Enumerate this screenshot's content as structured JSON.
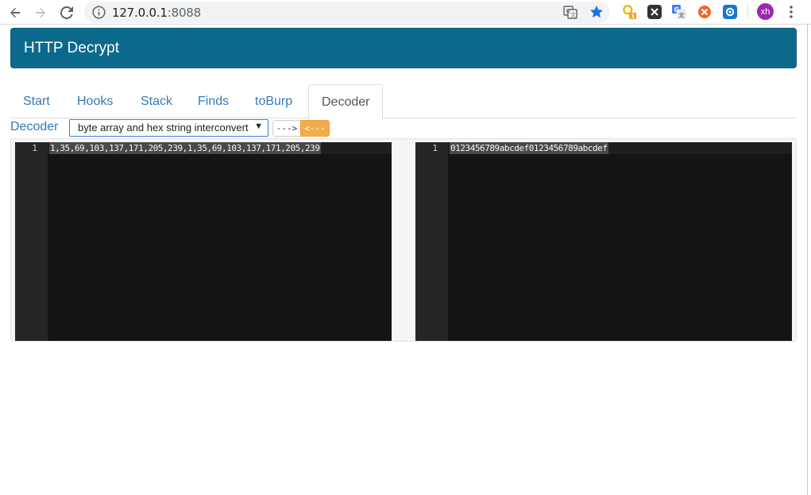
{
  "browser": {
    "url_host": "127.0.0.1",
    "url_port": ":8088",
    "avatar_initials": "xh",
    "extensions": [
      "translate-icon",
      "bookmark-star-icon",
      "key-extension-icon",
      "x-extension-icon",
      "google-translate-icon",
      "orange-extension-icon",
      "blue-extension-icon"
    ],
    "ext_badge": "1"
  },
  "header": {
    "title": "HTTP Decrypt"
  },
  "tabs": [
    {
      "label": "Start"
    },
    {
      "label": "Hooks"
    },
    {
      "label": "Stack"
    },
    {
      "label": "Finds"
    },
    {
      "label": "toBurp"
    },
    {
      "label": "Decoder",
      "active": true
    }
  ],
  "decoder": {
    "label": "Decoder",
    "mode_selected": "byte array and hex string interconvert",
    "forward_button": "--->",
    "backward_button": "<---"
  },
  "editors": {
    "left": {
      "line_number": "1",
      "content": "1,35,69,103,137,171,205,239,1,35,69,103,137,171,205,239"
    },
    "right": {
      "line_number": "1",
      "content": "0123456789abcdef0123456789abcdef"
    }
  },
  "colors": {
    "header_bg": "#0b6a8c",
    "link": "#337ab7",
    "warning_btn": "#f0ad4e",
    "editor_bg": "#141414"
  }
}
